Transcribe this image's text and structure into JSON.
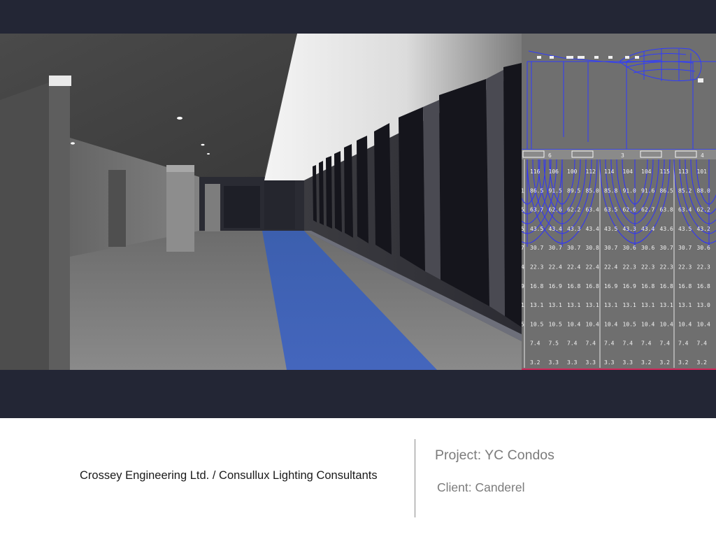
{
  "slide": {
    "company_credit": "Crossey Engineering Ltd. / Consullux Lighting Consultants",
    "project_line": "Project: YC Condos",
    "client_line": "Client: Canderel"
  },
  "images": {
    "render": "corridor-rendering",
    "calc": "photometric-calculation-grid"
  },
  "calc_grid": {
    "columns": 10,
    "rows": [
      [
        "116",
        "106",
        "100",
        "112",
        "114",
        "104",
        "104",
        "115",
        "113",
        "101"
      ],
      [
        "86.5",
        "91.5",
        "89.5",
        "85.0",
        "85.8",
        "91.0",
        "91.6",
        "86.5",
        "85.2",
        "88.0"
      ],
      [
        "63.7",
        "62.6",
        "62.2",
        "63.4",
        "63.5",
        "62.6",
        "62.7",
        "63.8",
        "63.4",
        "62.2"
      ],
      [
        "43.5",
        "43.4",
        "43.3",
        "43.4",
        "43.5",
        "43.3",
        "43.4",
        "43.6",
        "43.5",
        "43.2"
      ],
      [
        "30.7",
        "30.7",
        "30.7",
        "30.8",
        "30.7",
        "30.6",
        "30.6",
        "30.7",
        "30.7",
        "30.6"
      ],
      [
        "22.3",
        "22.4",
        "22.4",
        "22.4",
        "22.4",
        "22.3",
        "22.3",
        "22.3",
        "22.3",
        "22.3"
      ],
      [
        "16.8",
        "16.9",
        "16.8",
        "16.8",
        "16.9",
        "16.9",
        "16.8",
        "16.8",
        "16.8",
        "16.8"
      ],
      [
        "13.1",
        "13.1",
        "13.1",
        "13.1",
        "13.1",
        "13.1",
        "13.1",
        "13.1",
        "13.1",
        "13.0"
      ],
      [
        "10.5",
        "10.5",
        "10.4",
        "10.4",
        "10.4",
        "10.5",
        "10.4",
        "10.4",
        "10.4",
        "10.4"
      ],
      [
        "7.4",
        "7.5",
        "7.4",
        "7.4",
        "7.4",
        "7.4",
        "7.4",
        "7.4",
        "7.4",
        "7.4"
      ],
      [
        "3.2",
        "3.3",
        "3.3",
        "3.3",
        "3.3",
        "3.3",
        "3.2",
        "3.2",
        "3.2",
        "3.2"
      ]
    ],
    "left_edge_digits": [
      "",
      "1",
      "5",
      "5",
      "7",
      "4",
      "9",
      "1",
      "5",
      "",
      ""
    ],
    "header_marks": [
      "6",
      "3",
      "4"
    ]
  }
}
